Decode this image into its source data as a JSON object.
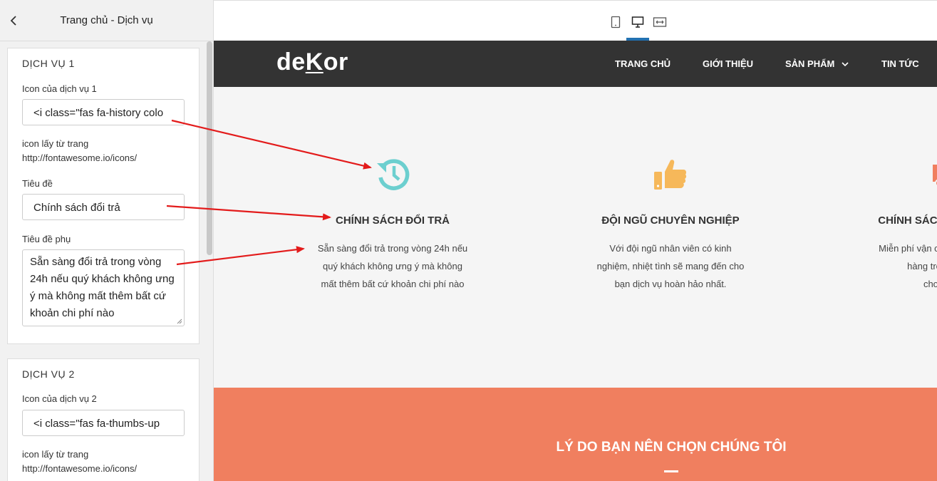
{
  "panel": {
    "title": "Trang chủ - Dịch vụ",
    "back_icon": "chevron-left-icon",
    "services": [
      {
        "heading": "DỊCH VỤ 1",
        "icon_label": "Icon của dịch vụ 1",
        "icon_value": "<i class=\"fas fa-history colo",
        "hint_line1": "icon lấy từ trang",
        "hint_line2": "http://fontawesome.io/icons/",
        "title_label": "Tiêu đề",
        "title_value": "Chính sách đổi trả",
        "subtitle_label": "Tiêu đề phụ",
        "subtitle_value": "Sẵn sàng đổi trả trong vòng 24h nếu quý khách không ưng ý mà không mất thêm bất cứ khoản chi phí nào"
      },
      {
        "heading": "DỊCH VỤ 2",
        "icon_label": "Icon của dịch vụ 2",
        "icon_value": "<i class=\"fas fa-thumbs-up",
        "hint_line1": "icon lấy từ trang",
        "hint_line2": "http://fontawesome.io/icons/"
      }
    ]
  },
  "toolbar": {
    "devices": [
      "mobile-icon",
      "desktop-icon",
      "fullwidth-icon"
    ],
    "active": "desktop-icon",
    "active_color": "#2271b1"
  },
  "site": {
    "logo": {
      "part1": "de",
      "part2": "K",
      "part3": "or"
    },
    "nav": [
      "TRANG CHỦ",
      "GIỚI THIỆU",
      "SẢN PHẨM",
      "TIN TỨC"
    ],
    "nav_bg": "#333333"
  },
  "services": [
    {
      "icon": "history-icon",
      "icon_color": "#6ccfcf",
      "title": "CHÍNH SÁCH ĐỔI TRẢ",
      "desc_lines": [
        "Sẵn sàng đổi trả trong vòng 24h nếu",
        "quý khách không ưng ý mà không",
        "mất thêm bất cứ khoản chi phí nào"
      ]
    },
    {
      "icon": "thumbs-up-icon",
      "icon_color": "#f6b85a",
      "title": "ĐỘI NGŨ CHUYÊN NGHIỆP",
      "desc_lines": [
        "Với đội ngũ nhân viên có kinh",
        "nghiệm, nhiệt tình sẽ mang đến cho",
        "bạn dịch vụ hoàn hảo nhất."
      ]
    },
    {
      "icon": "truck-icon",
      "icon_color": "#f07f5f",
      "title": "CHÍNH SÁCH VẬN CHUYỂN",
      "desc_lines": [
        "Miễn phí vận chuyển cho mọi đơn",
        "hàng trên toàn quốc",
        "cho các bạn"
      ]
    }
  ],
  "why": {
    "title": "LÝ DO BẠN NÊN CHỌN CHÚNG TÔI",
    "bg": "#f07f5f"
  },
  "annotation_color": "#e31b1b"
}
